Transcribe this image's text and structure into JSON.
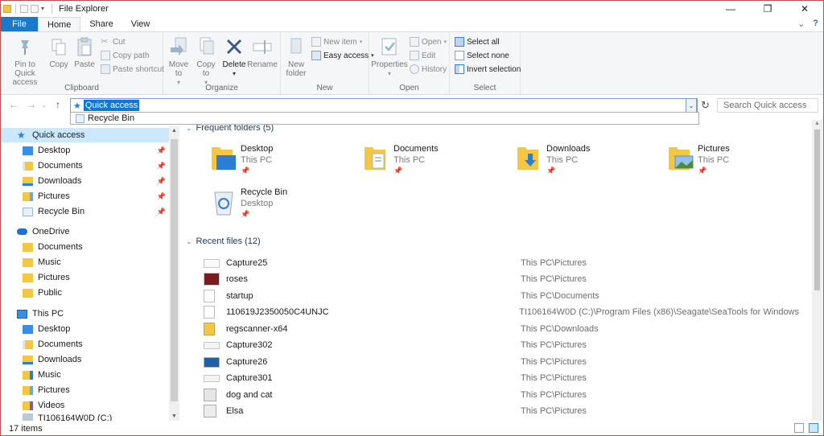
{
  "window": {
    "title": "File Explorer",
    "controls": {
      "minimize": "—",
      "maximize": "❐",
      "close": "✕"
    }
  },
  "ribbon_tabs": [
    "File",
    "Home",
    "Share",
    "View"
  ],
  "ribbon": {
    "clipboard": {
      "group_label": "Clipboard",
      "pin": "Pin to Quick access",
      "copy": "Copy",
      "paste": "Paste",
      "cut": "Cut",
      "copy_path": "Copy path",
      "paste_shortcut": "Paste shortcut"
    },
    "organize": {
      "group_label": "Organize",
      "move_to": "Move to",
      "copy_to": "Copy to",
      "delete": "Delete",
      "rename": "Rename"
    },
    "new": {
      "group_label": "New",
      "new_folder": "New folder",
      "new_item": "New item",
      "easy_access": "Easy access"
    },
    "open": {
      "group_label": "Open",
      "properties": "Properties",
      "open": "Open",
      "edit": "Edit",
      "history": "History"
    },
    "select": {
      "group_label": "Select",
      "select_all": "Select all",
      "select_none": "Select none",
      "invert_selection": "Invert selection"
    }
  },
  "address_bar": {
    "value": "Quick access",
    "autocomplete_item": "Recycle Bin",
    "search_placeholder": "Search Quick access"
  },
  "nav_pane": {
    "quick_access": {
      "label": "Quick access",
      "items": [
        "Desktop",
        "Documents",
        "Downloads",
        "Pictures",
        "Recycle Bin"
      ]
    },
    "onedrive": {
      "label": "OneDrive",
      "items": [
        "Documents",
        "Music",
        "Pictures",
        "Public"
      ]
    },
    "this_pc": {
      "label": "This PC",
      "items": [
        "Desktop",
        "Documents",
        "Downloads",
        "Music",
        "Pictures",
        "Videos",
        "TI106164W0D (C:)"
      ]
    }
  },
  "frequent_folders": {
    "header": "Frequent folders (5)",
    "items": [
      {
        "name": "Desktop",
        "location": "This PC"
      },
      {
        "name": "Documents",
        "location": "This PC"
      },
      {
        "name": "Downloads",
        "location": "This PC"
      },
      {
        "name": "Pictures",
        "location": "This PC"
      },
      {
        "name": "Recycle Bin",
        "location": "Desktop"
      }
    ]
  },
  "recent_files": {
    "header": "Recent files (12)",
    "items": [
      {
        "name": "Capture25",
        "location": "This PC\\Pictures"
      },
      {
        "name": "roses",
        "location": "This PC\\Pictures"
      },
      {
        "name": "startup",
        "location": "This PC\\Documents"
      },
      {
        "name": "110619J2350050C4UNJC",
        "location": "TI106164W0D (C:)\\Program Files (x86)\\Seagate\\SeaTools for Windows"
      },
      {
        "name": "regscanner-x64",
        "location": "This PC\\Downloads"
      },
      {
        "name": "Capture302",
        "location": "This PC\\Pictures"
      },
      {
        "name": "Capture26",
        "location": "This PC\\Pictures"
      },
      {
        "name": "Capture301",
        "location": "This PC\\Pictures"
      },
      {
        "name": "dog and cat",
        "location": "This PC\\Pictures"
      },
      {
        "name": "Elsa",
        "location": "This PC\\Pictures"
      }
    ]
  },
  "status_bar": {
    "item_count": "17 items"
  },
  "colors": {
    "accent": "#1979ca",
    "selection": "#cce8ff",
    "folder": "#f3c744"
  }
}
